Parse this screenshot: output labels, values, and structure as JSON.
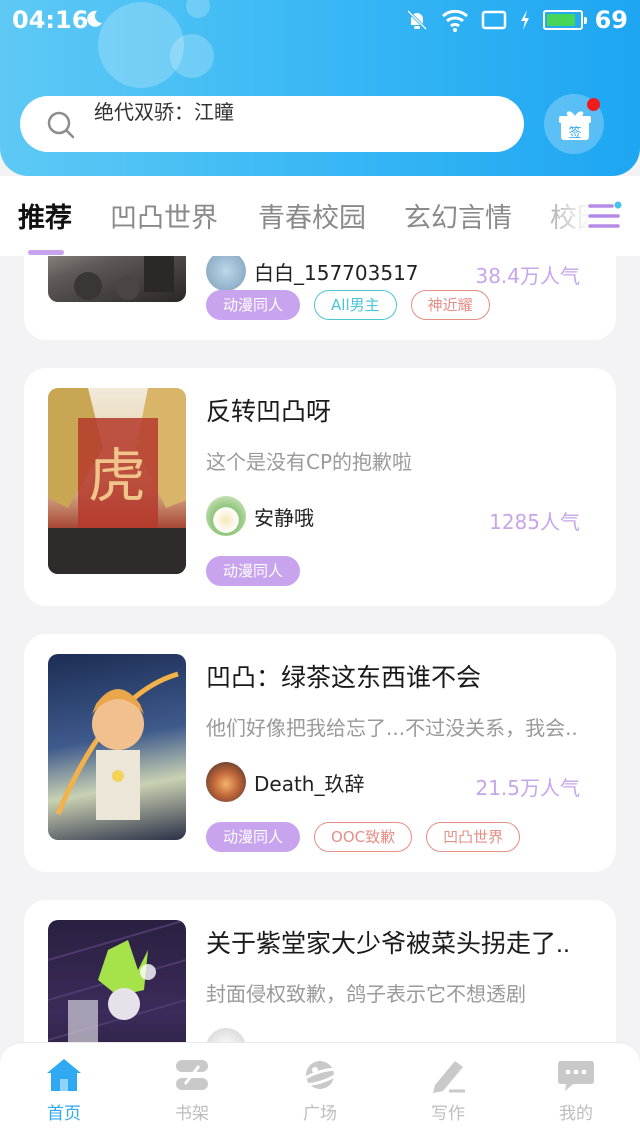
{
  "status_bar": {
    "time": "04:16",
    "battery": "69"
  },
  "search": {
    "placeholder": "绝代双骄：江瞳"
  },
  "checkin": {
    "label": "签"
  },
  "tabs": [
    {
      "label": "推荐",
      "active": true
    },
    {
      "label": "凹凸世界"
    },
    {
      "label": "青春校园"
    },
    {
      "label": "玄幻言情"
    },
    {
      "label": "校园"
    }
  ],
  "feed": [
    {
      "author": "白白_157703517",
      "popularity": "38.4万人气",
      "tags": [
        "动漫同人",
        "All男主",
        "神近耀"
      ]
    },
    {
      "title": "反转凹凸呀",
      "desc": "这个是没有CP的抱歉啦",
      "author": "安静哦",
      "popularity": "1285人气",
      "tags": [
        "动漫同人"
      ],
      "cover_text": "虎"
    },
    {
      "title": "凹凸：绿茶这东西谁不会",
      "desc": "他们好像把我给忘了...不过没关系，我会..",
      "author": "Death_玖辞",
      "popularity": "21.5万人气",
      "tags": [
        "动漫同人",
        "OOC致歉",
        "凹凸世界"
      ]
    },
    {
      "title": "关于紫堂家大少爷被菜头拐走了..",
      "desc": "封面侵权致歉，鸽子表示它不想透剧"
    }
  ],
  "bottom_nav": [
    {
      "label": "首页",
      "icon": "home-icon",
      "active": true
    },
    {
      "label": "书架",
      "icon": "bookshelf-icon"
    },
    {
      "label": "广场",
      "icon": "planet-icon"
    },
    {
      "label": "写作",
      "icon": "pen-icon"
    },
    {
      "label": "我的",
      "icon": "chat-icon"
    }
  ],
  "colors": {
    "header_blue": "#1ea6f2",
    "accent_purple": "#c9a4ee",
    "tag_blue": "#4cc6d6",
    "tag_red": "#e58f86",
    "nav_active": "#2fa9f1"
  }
}
